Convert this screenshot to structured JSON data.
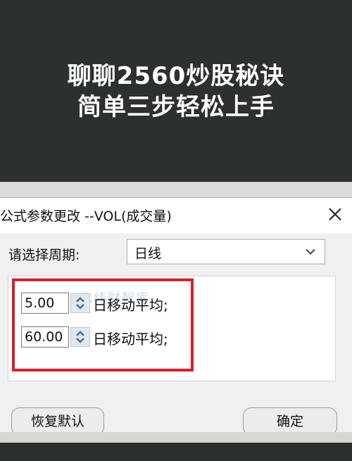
{
  "hero": {
    "line1": "聊聊2560炒股秘诀",
    "line2": "简单三步轻松上手"
  },
  "dialog": {
    "title": "公式参数更改 --VOL(成交量)",
    "period_label": "请选择周期:",
    "period_value": "日线",
    "params": [
      {
        "value": "5.00",
        "suffix": "日移动平均;"
      },
      {
        "value": "60.00",
        "suffix": "日移动平均;"
      }
    ],
    "watermark": "北纬财智库",
    "restore_label": "恢复默认",
    "ok_label": "确定"
  },
  "colors": {
    "background": "#2c302e",
    "highlight": "#d8202a"
  },
  "icons": {
    "close": "close-icon",
    "dropdown": "chevron-down-icon",
    "spinner": "spinner-updown-icon"
  }
}
